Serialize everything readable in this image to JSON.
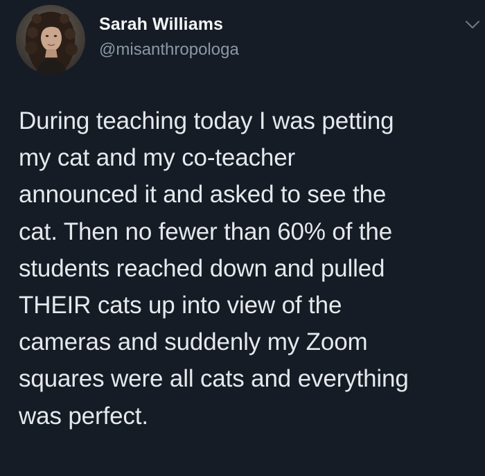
{
  "author": {
    "display_name": "Sarah Williams",
    "handle": "@misanthropologa",
    "avatar_icon": "profile-photo-avatar"
  },
  "menu": {
    "icon": "chevron-down-icon"
  },
  "tweet": {
    "lines": [
      "During teaching today I was petting",
      "my cat and my co-teacher",
      "announced it and asked to see the",
      "cat. Then no fewer than 60% of the",
      "students reached down and pulled",
      "THEIR cats up into view of the",
      "cameras and suddenly my Zoom",
      "squares were all cats and everything",
      "was perfect."
    ]
  },
  "colors": {
    "background": "#151c26",
    "text": "#e6e9ec",
    "handle": "#8b98a5"
  }
}
